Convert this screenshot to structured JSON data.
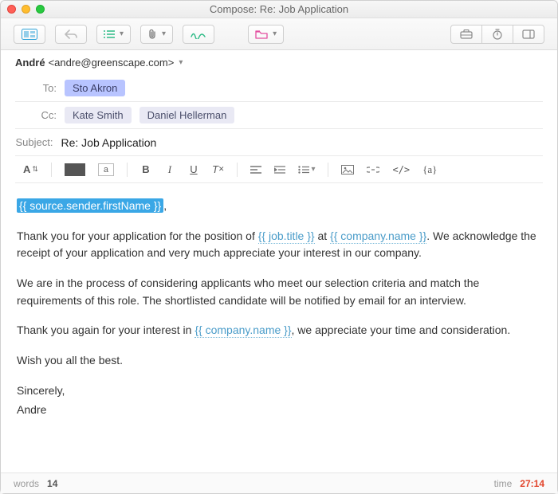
{
  "window": {
    "title": "Compose: Re: Job Application"
  },
  "from": {
    "name": "André",
    "email": "<andre@greenscape.com>"
  },
  "to": {
    "label": "To:",
    "chips": [
      "Sto Akron"
    ]
  },
  "cc": {
    "label": "Cc:",
    "chips": [
      "Kate Smith",
      "Daniel Hellerman"
    ]
  },
  "subject": {
    "label": "Subject:",
    "value": "Re: Job Application"
  },
  "format": {
    "font_label": "A",
    "a_box": "a",
    "curly": "{a}"
  },
  "body": {
    "greeting_var": "{{ source.sender.firstName }}",
    "greeting_punct": ",",
    "p1_a": "Thank you for your application for the position of ",
    "var_job": "{{ job.title }}",
    "p1_b": " at ",
    "var_company": "{{ company.name }}",
    "p1_c": ". We acknowledge the receipt of your application and very much appreciate your interest in our company.",
    "p2": "We are in the process of considering applicants who meet our selection criteria and match the requirements of this role. The shortlisted candidate will be notified by email for an interview.",
    "p3_a": "Thank you again for your interest in ",
    "p3_b": ", we appreciate your time and consideration.",
    "p4": "Wish you all the best.",
    "signoff": "Sincerely,",
    "signer": "Andre"
  },
  "status": {
    "words_label": "words",
    "words_value": "14",
    "time_label": "time",
    "time_value": "27:14"
  }
}
